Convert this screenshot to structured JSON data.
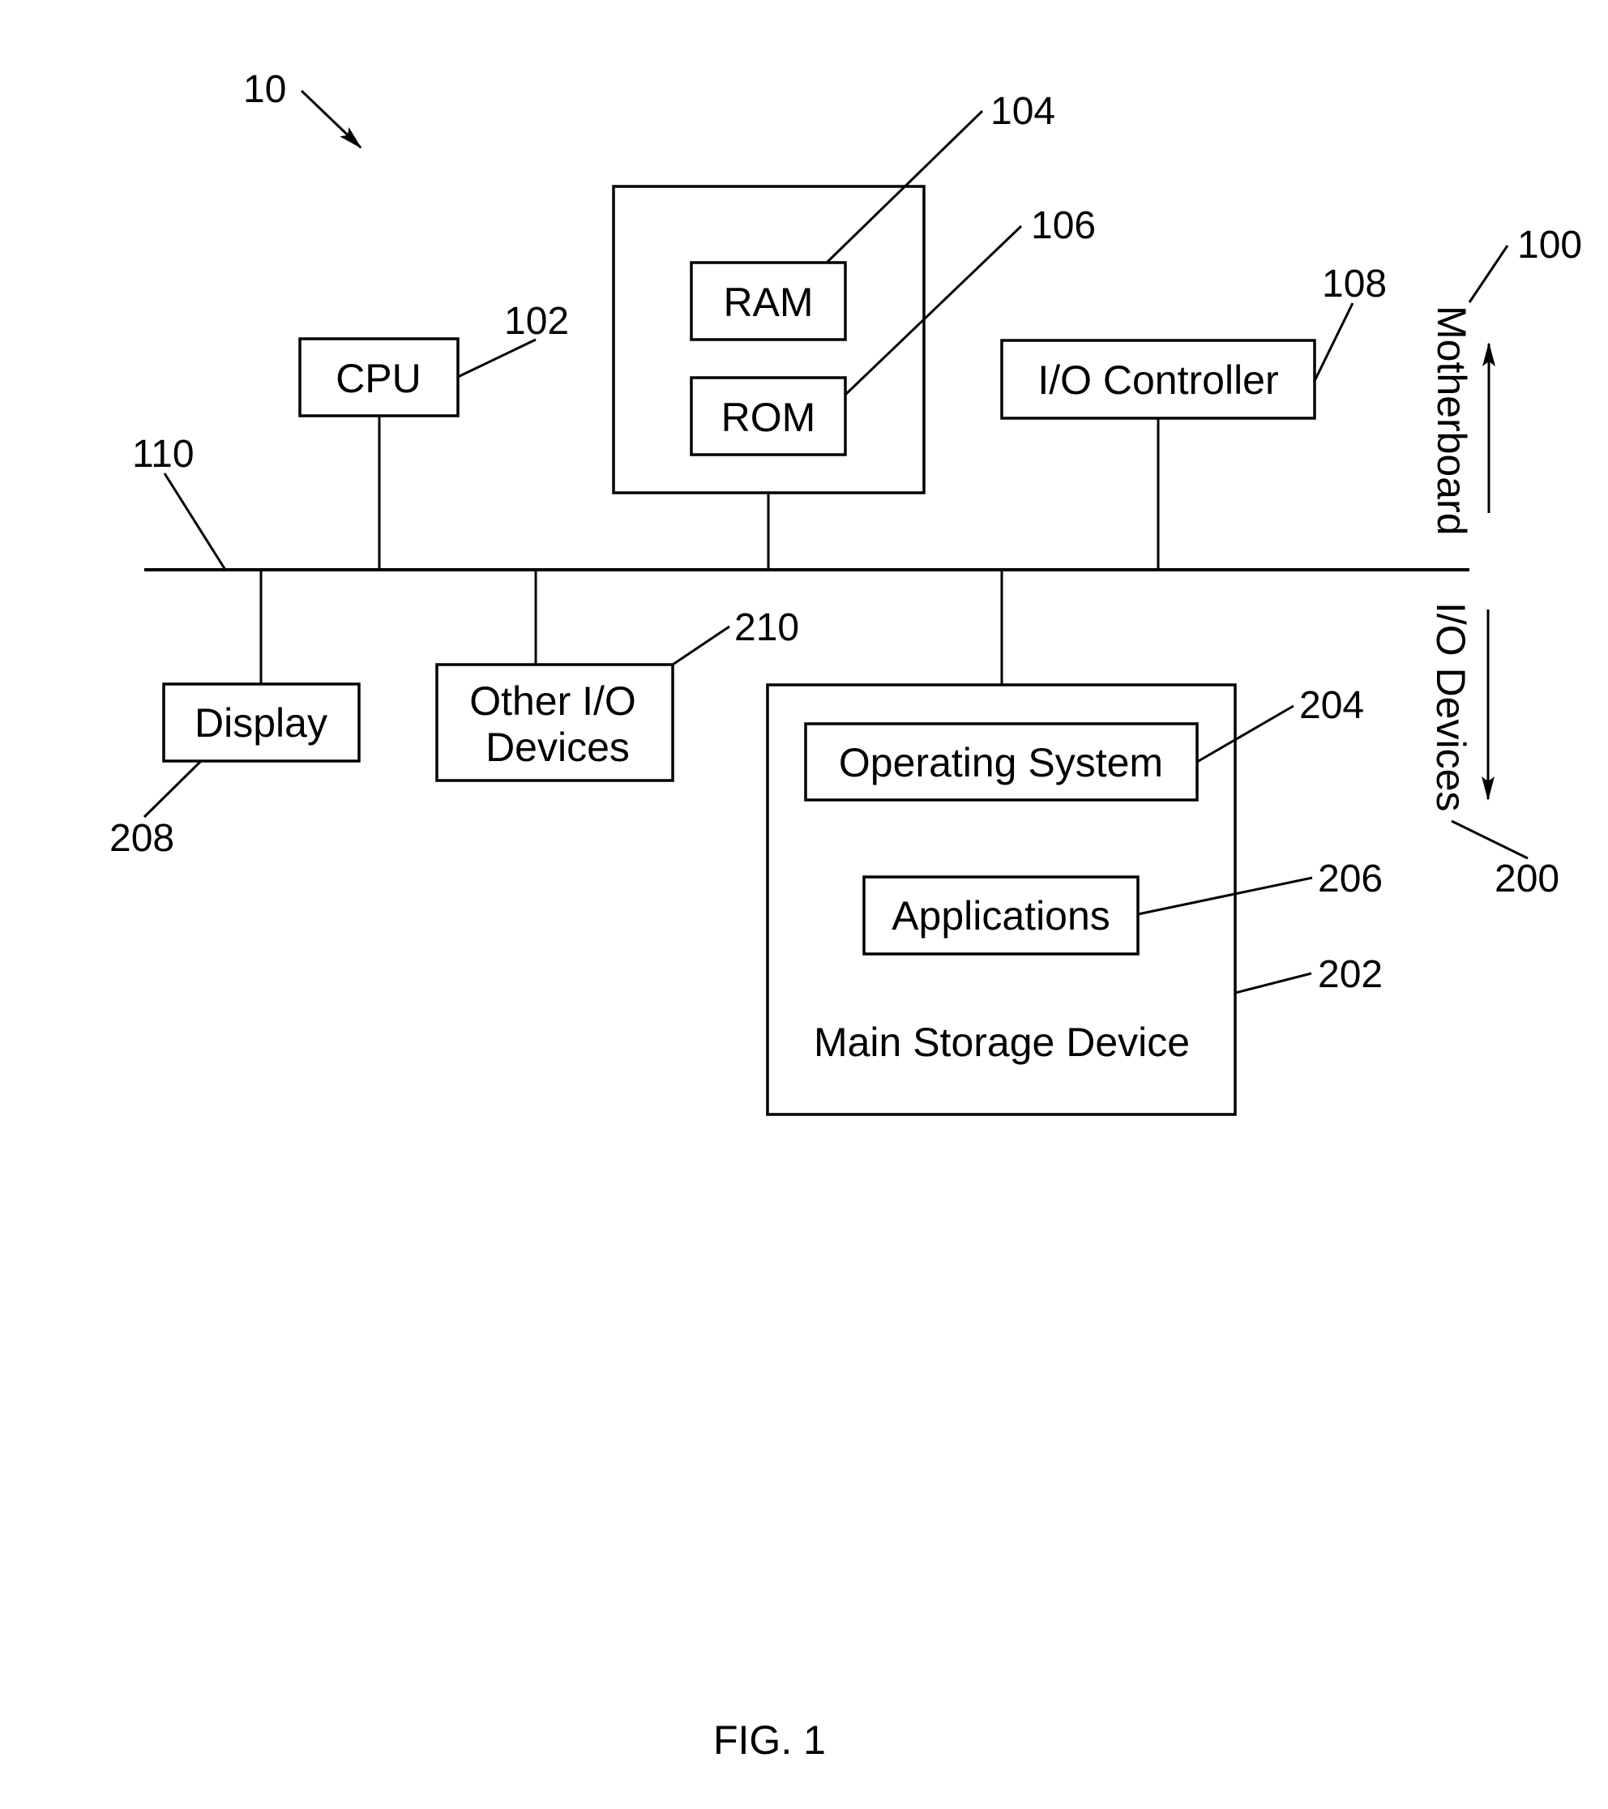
{
  "figure": {
    "caption": "FIG. 1",
    "system_ref": "10",
    "bus_ref": "110"
  },
  "motherboard": {
    "label": "Motherboard",
    "ref": "100",
    "cpu": {
      "label": "CPU",
      "ref": "102"
    },
    "ram": {
      "label": "RAM",
      "ref": "104"
    },
    "rom": {
      "label": "ROM",
      "ref": "106"
    },
    "io_controller": {
      "label": "I/O Controller",
      "ref": "108"
    }
  },
  "io_devices": {
    "label": "I/O Devices",
    "ref": "200",
    "main_storage": {
      "label": "Main Storage Device",
      "ref": "202"
    },
    "operating_system": {
      "label": "Operating System",
      "ref": "204"
    },
    "applications": {
      "label": "Applications",
      "ref": "206"
    },
    "display": {
      "label": "Display",
      "ref": "208"
    },
    "other_io": {
      "label_line1": "Other I/O",
      "label_line2": "Devices",
      "ref": "210"
    }
  }
}
